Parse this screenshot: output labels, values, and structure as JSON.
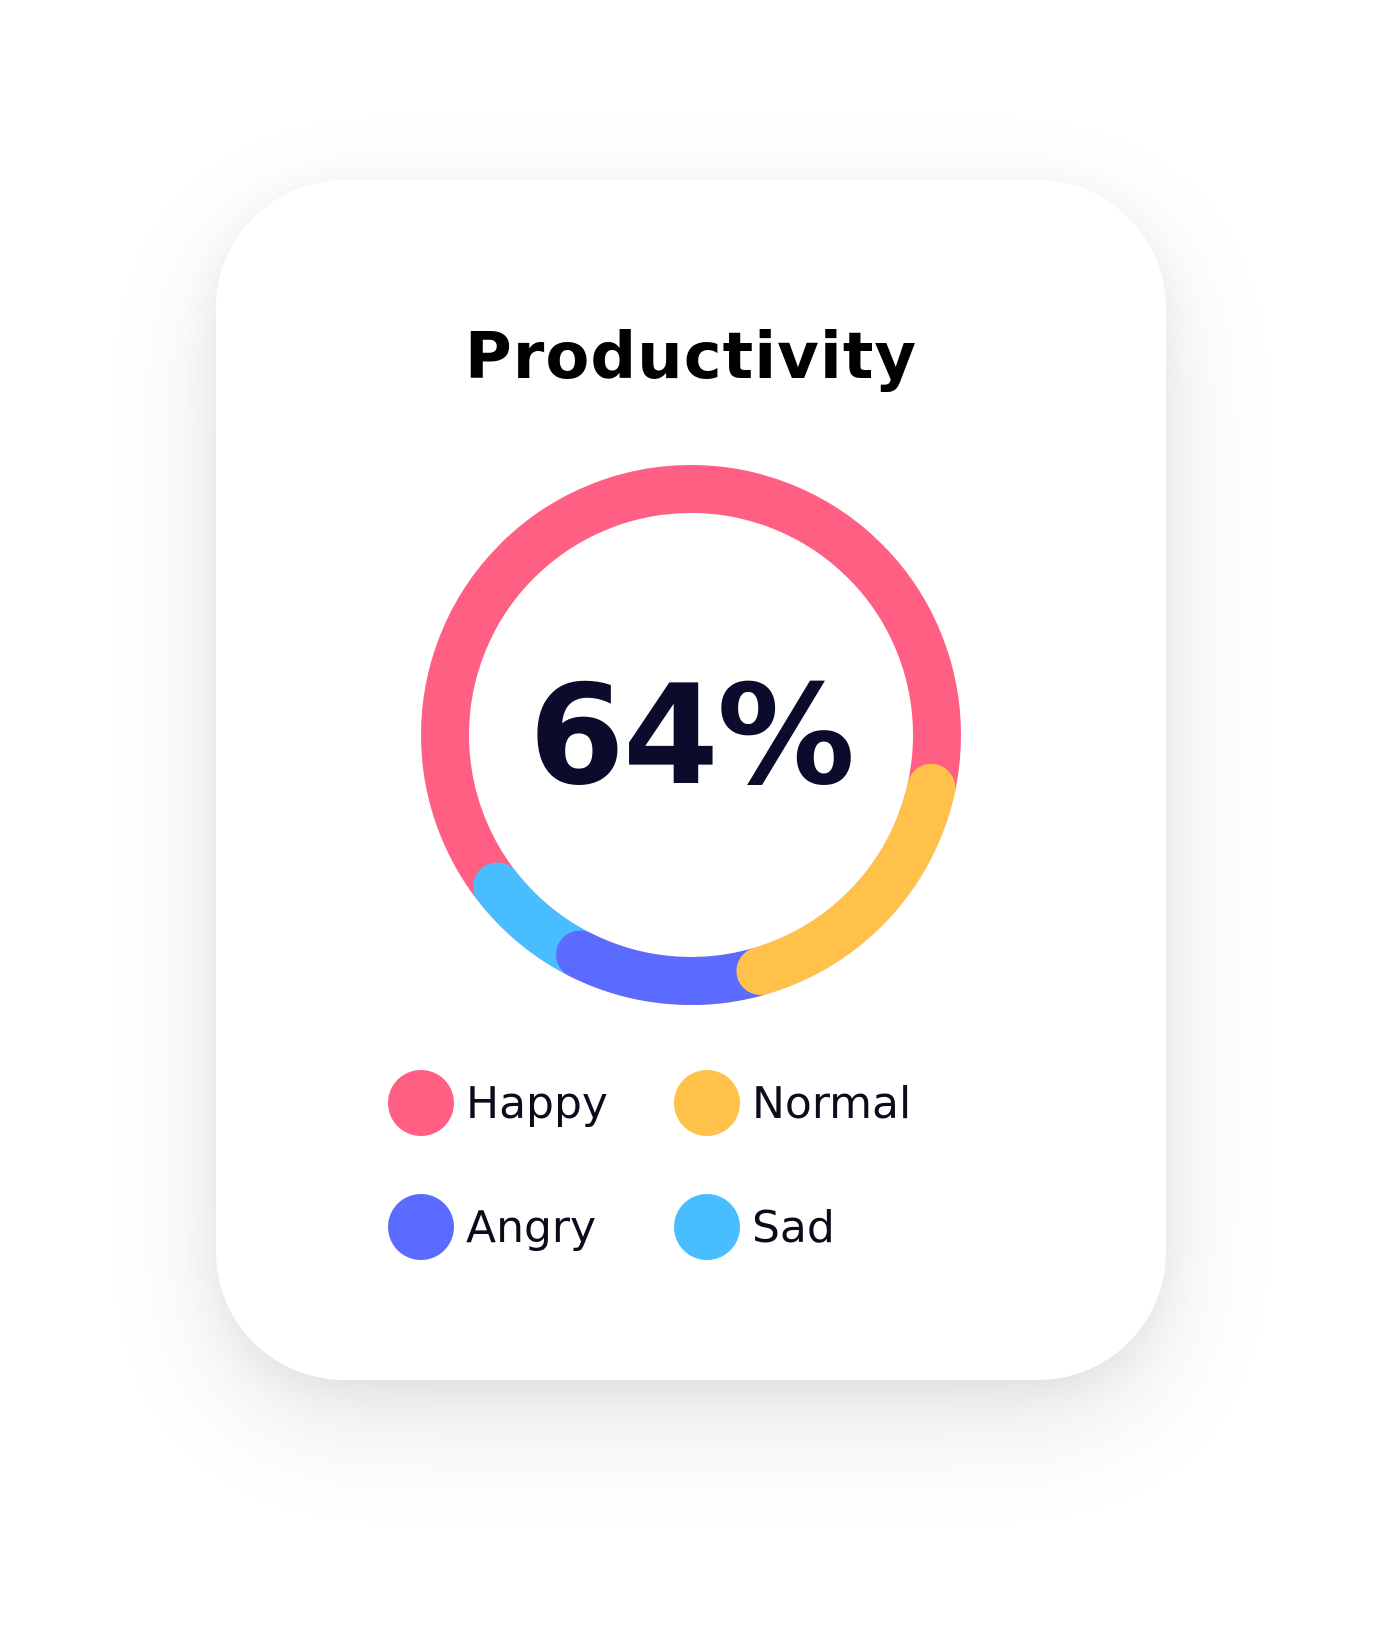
{
  "chart_data": {
    "type": "donut",
    "title": "Productivity",
    "center_label": "64%",
    "series": [
      {
        "name": "Happy",
        "value": 64,
        "color": "#ff5f82"
      },
      {
        "name": "Normal",
        "value": 17,
        "color": "#ffc14a"
      },
      {
        "name": "Angry",
        "value": 12,
        "color": "#5b6bff"
      },
      {
        "name": "Sad",
        "value": 7,
        "color": "#48bdff"
      }
    ],
    "legend": {
      "placement": "bottom",
      "items": [
        {
          "label": "Happy",
          "color": "#ff5f82"
        },
        {
          "label": "Normal",
          "color": "#ffc14a"
        },
        {
          "label": "Angry",
          "color": "#5b6bff"
        },
        {
          "label": "Sad",
          "color": "#48bdff"
        }
      ]
    }
  }
}
